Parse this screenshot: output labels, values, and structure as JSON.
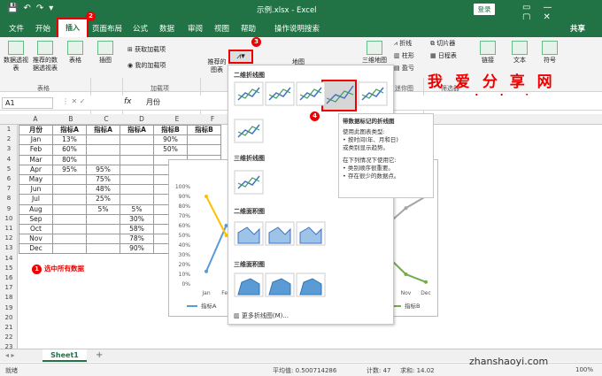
{
  "window": {
    "title": "示例.xlsx - Excel",
    "login": "登录",
    "share": "共享"
  },
  "tabs": [
    "文件",
    "开始",
    "插入",
    "页面布局",
    "公式",
    "数据",
    "审阅",
    "视图",
    "帮助",
    "操作说明搜索"
  ],
  "ribbon": {
    "buttons": [
      "数据透视表",
      "推荐的数据透视表",
      "表格",
      "插图",
      "获取加载项",
      "我的加载项",
      "推荐的图表",
      "地图",
      "数据透视图",
      "三维地图",
      "折线",
      "柱形",
      "盈亏",
      "切片器",
      "日程表",
      "链接",
      "文本",
      "符号"
    ],
    "groups": [
      "表格",
      "加载项",
      "迷你图",
      "筛选器"
    ]
  },
  "formula_bar": {
    "name_box": "A1",
    "fx": "fx",
    "value": "月份"
  },
  "columns": [
    "A",
    "B",
    "C",
    "D",
    "E",
    "F"
  ],
  "row_numbers": [
    "1",
    "2",
    "3",
    "4",
    "5",
    "6",
    "7",
    "8",
    "9",
    "10",
    "11",
    "12",
    "13",
    "14",
    "15",
    "16",
    "17",
    "18",
    "19",
    "20",
    "21",
    "22",
    "23"
  ],
  "table": {
    "headers": [
      "月份",
      "指标A",
      "指标A",
      "指标A",
      "指标B",
      "指标B"
    ],
    "rows": [
      [
        "Jan",
        "13%",
        "",
        "",
        "90%",
        ""
      ],
      [
        "Feb",
        "60%",
        "",
        "",
        "50%",
        ""
      ],
      [
        "Mar",
        "80%",
        "",
        "",
        "",
        ""
      ],
      [
        "Apr",
        "95%",
        "95%",
        "",
        "",
        ""
      ],
      [
        "May",
        "",
        "75%",
        "",
        "",
        ""
      ],
      [
        "Jun",
        "",
        "48%",
        "",
        "",
        ""
      ],
      [
        "Jul",
        "",
        "25%",
        "",
        "",
        ""
      ],
      [
        "Aug",
        "",
        "5%",
        "5%",
        "",
        ""
      ],
      [
        "Sep",
        "",
        "",
        "30%",
        "",
        ""
      ],
      [
        "Oct",
        "",
        "",
        "58%",
        "",
        ""
      ],
      [
        "Nov",
        "",
        "",
        "78%",
        "",
        ""
      ],
      [
        "Dec",
        "",
        "",
        "90%",
        "",
        ""
      ]
    ]
  },
  "chart_data": {
    "type": "line",
    "categories": [
      "Jan",
      "Feb",
      "Mar",
      "Apr",
      "May",
      "Jun",
      "Jul",
      "Aug",
      "Sep",
      "Oct",
      "Nov",
      "Dec"
    ],
    "series": [
      {
        "name": "指标A",
        "color": "#5b9bd5",
        "values": [
          13,
          60,
          null,
          null,
          null,
          null,
          null,
          null,
          null,
          null,
          null,
          null
        ]
      },
      {
        "name": "",
        "color": "#ffc000",
        "values": [
          90,
          50,
          null,
          null,
          null,
          null,
          null,
          null,
          null,
          null,
          null,
          null
        ]
      },
      {
        "name": "",
        "color": "#a5a5a5",
        "values": [
          null,
          null,
          null,
          null,
          null,
          null,
          null,
          null,
          null,
          60,
          78,
          90
        ]
      },
      {
        "name": "指标B",
        "color": "#70ad47",
        "values": [
          null,
          null,
          null,
          null,
          null,
          null,
          null,
          null,
          null,
          30,
          10,
          2
        ]
      }
    ],
    "yticks": [
      "100%",
      "90%",
      "80%",
      "70%",
      "60%",
      "50%",
      "40%",
      "30%",
      "20%",
      "10%",
      "0%"
    ],
    "xtick_labels": [
      "Jan",
      "Feb",
      "Nov",
      "Dec"
    ],
    "ylim": [
      0,
      100
    ]
  },
  "dropdown": {
    "sections": [
      "二维折线图",
      "三维折线图",
      "二维面积图",
      "三维面积图"
    ],
    "more": "更多折线图(M)..."
  },
  "tooltip": {
    "title": "带数据标记的折线图",
    "lines": [
      "使用此图表类型:",
      "• 按时间(年、月和日)",
      "或类别显示趋势。",
      "",
      "在下列情况下使用它:",
      "• 类别顺序很重要。",
      "• 存在很少的数据点。"
    ]
  },
  "annotations": {
    "step1": "选中所有数据",
    "badges": [
      "1",
      "2",
      "3",
      "4"
    ]
  },
  "watermark": {
    "title": "我 爱 分 享 网",
    "url": "www.zhanshaoyi.com",
    "url2": "zhanshaoyi.com"
  },
  "sheet": {
    "tab": "Sheet1",
    "add": "+"
  },
  "status": {
    "ready": "就绪",
    "average": "平均值: 0.500714286",
    "count": "计数: 47",
    "sum": "求和: 14.02",
    "zoom": "100%"
  }
}
